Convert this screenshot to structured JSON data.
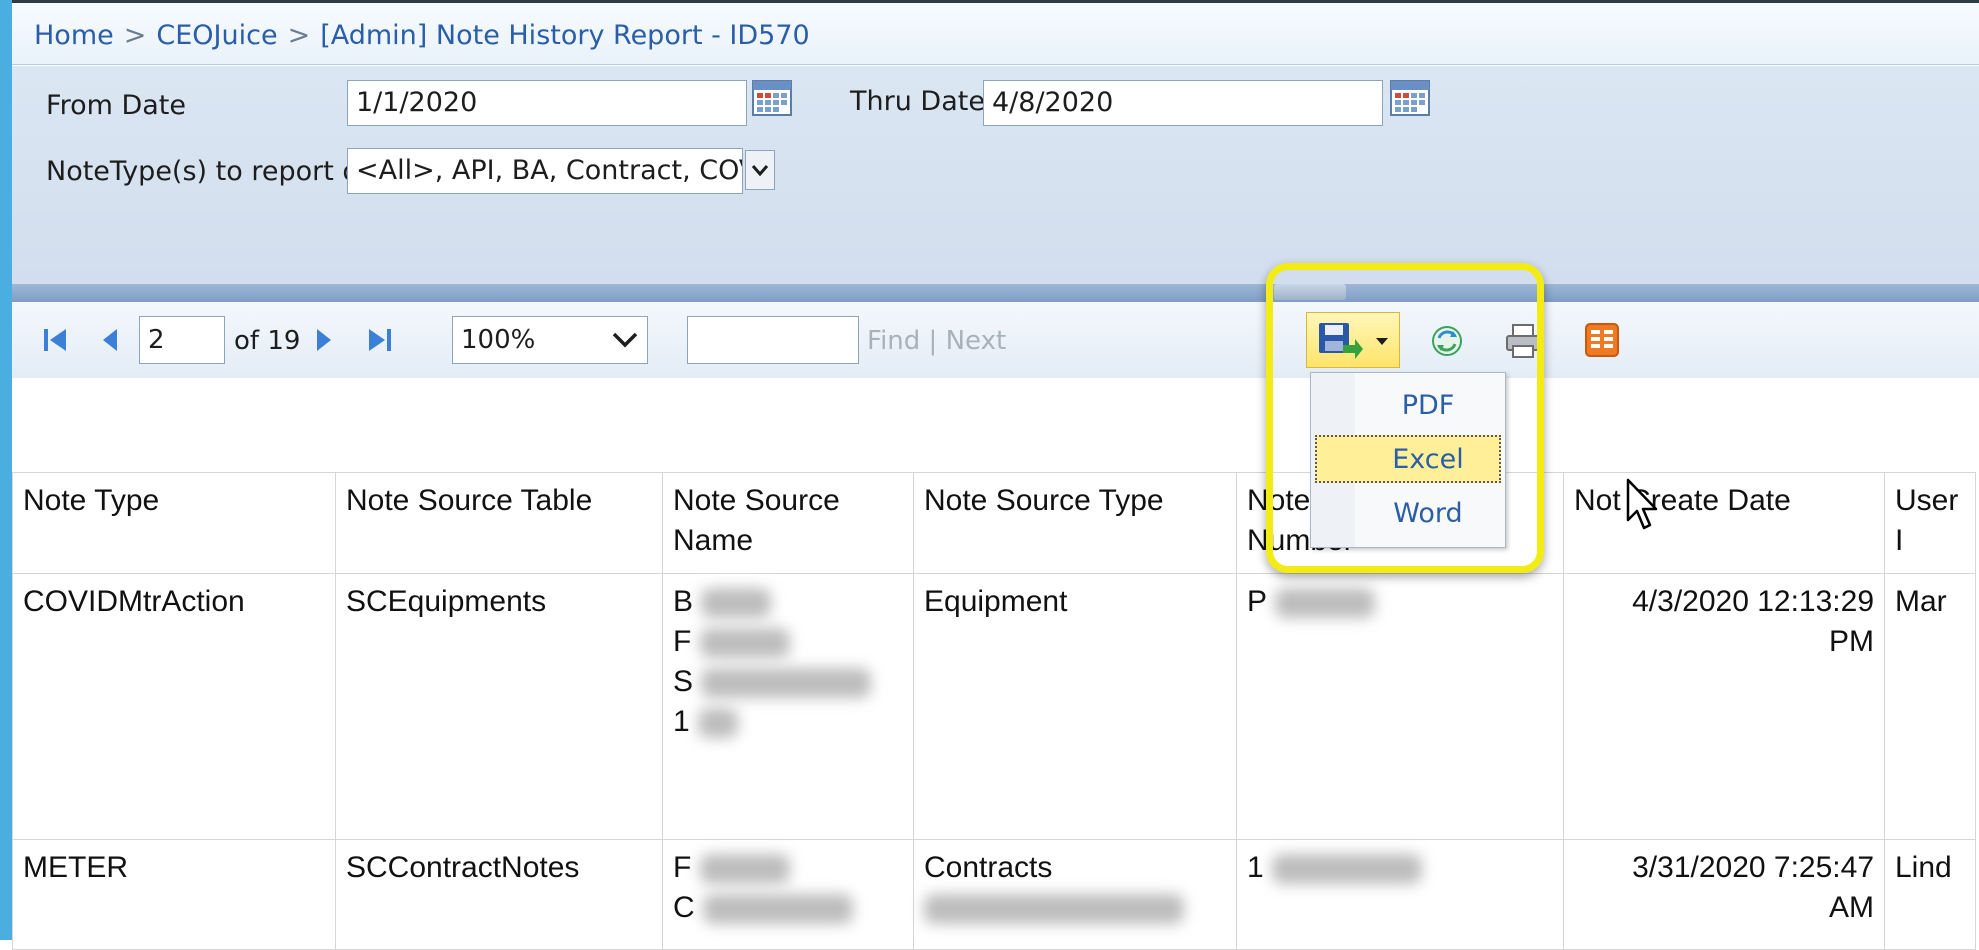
{
  "breadcrumb": {
    "items": [
      "Home",
      "CEOJuice",
      "[Admin] Note History Report - ID570"
    ],
    "separator": ">"
  },
  "params": {
    "from_date_label": "From Date",
    "from_date_value": "1/1/2020",
    "thru_date_label": "Thru Date",
    "thru_date_value": "4/8/2020",
    "notetype_label": "NoteType(s) to report on",
    "notetype_value": "<All>, API, BA, Contract, COVID"
  },
  "toolbar": {
    "current_page": "2",
    "of_pages": "of 19",
    "zoom": "100%",
    "find_label": "Find",
    "next_label": "Next",
    "find_separator": "|"
  },
  "export_menu": {
    "items": [
      "PDF",
      "Excel",
      "Word"
    ],
    "active": "Excel"
  },
  "table": {
    "columns": [
      "Note Type",
      "Note Source Table",
      "Note Source Name",
      "Note Source Type",
      "Note Number",
      "Note Create Date",
      "User"
    ],
    "header_display": {
      "source_name_l1": "Note Source",
      "source_name_l2": "Name",
      "note_number_l1": "Note",
      "note_number_l2": "Number",
      "create_date_l1": "Not",
      "create_date_l2": "Create Date",
      "user_partial": "User I"
    },
    "rows": [
      {
        "note_type": "COVIDMtrAction",
        "source_table": "SCEquipments",
        "source_name_visible": [
          "B",
          "F",
          "S",
          "1"
        ],
        "source_type": "Equipment",
        "note_number_visible": "P",
        "create_date_l1": "4/3/2020 12:13:29",
        "create_date_l2": "PM",
        "user_partial": "Mar"
      },
      {
        "note_type": "METER",
        "source_table": "SCContractNotes",
        "source_name_visible": [
          "F",
          "C"
        ],
        "source_type": "Contracts",
        "note_number_visible": "1",
        "create_date_l1": "3/31/2020 7:25:47",
        "create_date_l2": "AM",
        "user_partial": "Lind"
      }
    ]
  },
  "colors": {
    "accent_blue": "#2a5ea8",
    "highlight_yellow": "#f2ec14",
    "panel_bg": "#d6e1ef"
  },
  "icons": [
    "first-page-icon",
    "prev-page-icon",
    "next-page-icon",
    "last-page-icon",
    "calendar-icon",
    "save-export-icon",
    "refresh-icon",
    "print-icon",
    "layout-icon",
    "dropdown-arrow-icon",
    "mouse-cursor-icon"
  ]
}
